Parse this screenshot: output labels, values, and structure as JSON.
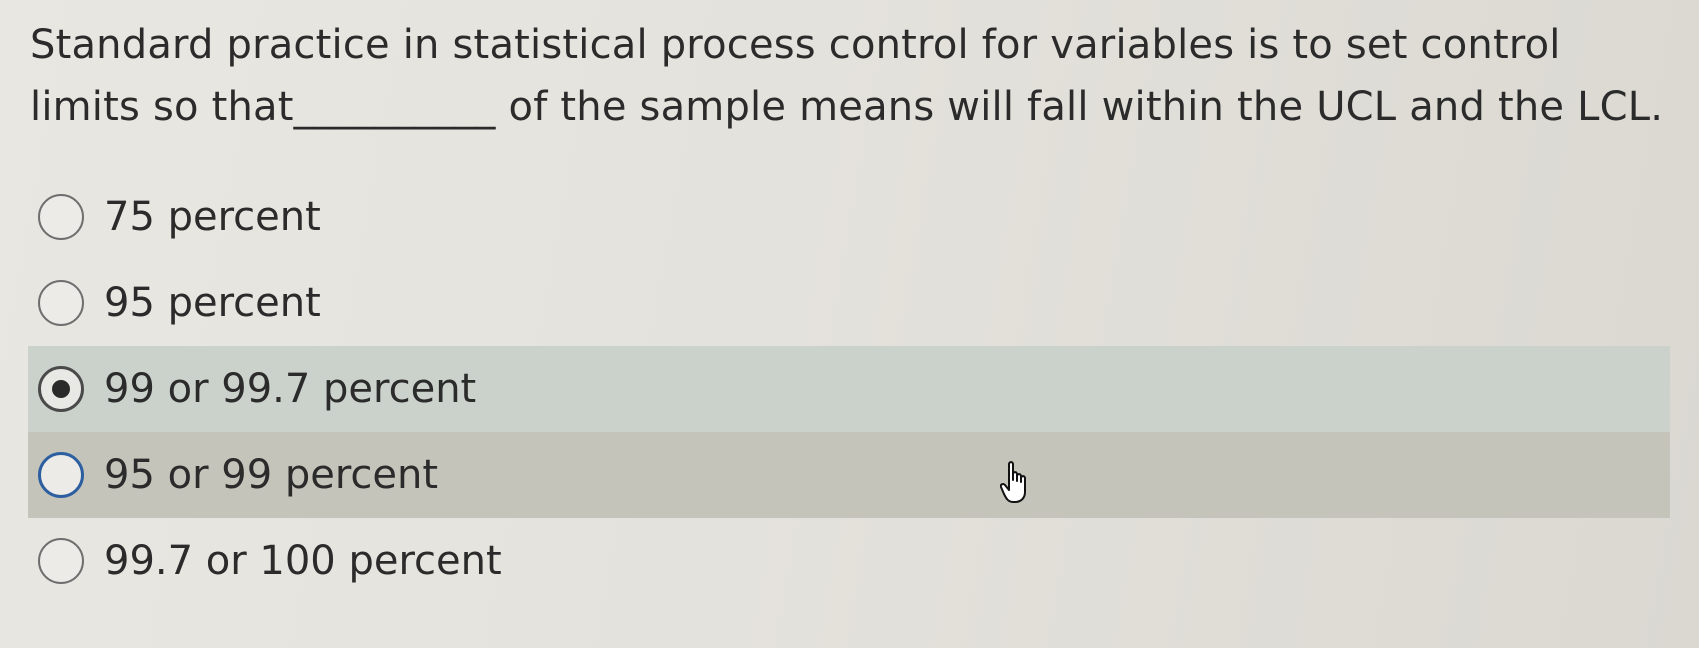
{
  "question": {
    "text": "Standard practice in statistical process control for variables is to set control limits so that__________ of the sample means will fall within the UCL and the LCL."
  },
  "options": [
    {
      "label": "75 percent",
      "selected": false
    },
    {
      "label": "95 percent",
      "selected": false
    },
    {
      "label": "99 or 99.7 percent",
      "selected": true
    },
    {
      "label": "95 or 99 percent",
      "selected": false,
      "hovered": true
    },
    {
      "label": "99.7 or 100 percent",
      "selected": false
    }
  ],
  "cursor": {
    "icon": "hand-pointer-icon"
  },
  "colors": {
    "background": "#e6e4de",
    "selected_row": "#cbd2cc",
    "hovered_row": "#c4c4bb",
    "focus_ring": "#2d5fa0"
  }
}
